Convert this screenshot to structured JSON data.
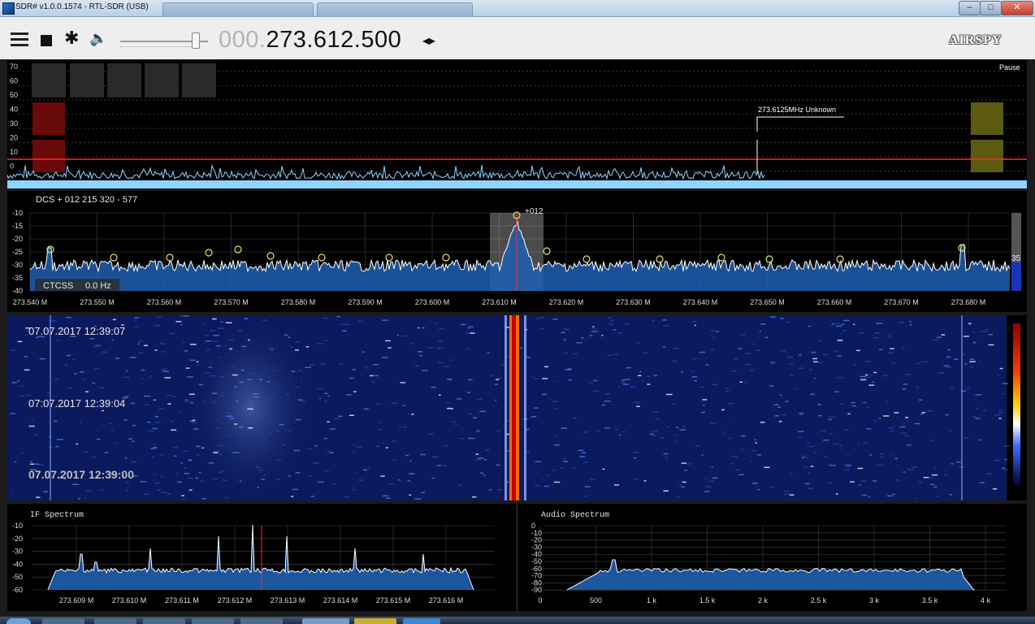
{
  "window": {
    "title": "SDR# v1.0.0.1574 - RTL-SDR (USB)",
    "minimize_glyph": "–",
    "maximize_glyph": "□",
    "close_glyph": "✕"
  },
  "toolbar": {
    "icons": [
      "menu-icon",
      "stop-icon",
      "gear-icon",
      "speaker-icon"
    ],
    "volume_level": 0.88,
    "frequency_dim": "000.",
    "frequency_main": "273.612.500",
    "tune_arrows_glyph": "◂▸",
    "logo": "AIRSPY"
  },
  "scanner": {
    "pause_label": "Pause",
    "y_ticks": [
      "70",
      "60",
      "50",
      "40",
      "30",
      "20",
      "10",
      "0"
    ],
    "marker_label": "273.6125MHz Unknown",
    "colors": {
      "trace": "#8fd3ff",
      "threshold": "#ff2a2a",
      "red_block": "#6a0a0a",
      "yellow_block": "#5c5a10"
    }
  },
  "spectrum": {
    "dcs_label": "DCS + 012 215 320  - 577",
    "ctcss_label": "CTCSS",
    "ctcss_value": "0.0 Hz",
    "peak_label": "+012",
    "level_value": "35",
    "y_ticks": [
      "-10",
      "-15",
      "-20",
      "-25",
      "-30",
      "-35",
      "-40"
    ],
    "x_ticks": [
      "273.540 M",
      "273.550 M",
      "273.560 M",
      "273.570 M",
      "273.580 M",
      "273.590 M",
      "273.600 M",
      "273.610 M",
      "273.620 M",
      "273.630 M",
      "273.640 M",
      "273.650 M",
      "273.660 M",
      "273.670 M",
      "273.680 M"
    ],
    "colors": {
      "fill": "#1e5fb0",
      "line": "#ffffff",
      "marker": "#e8e36a",
      "filter": "#d8d8d8"
    }
  },
  "waterfall": {
    "timestamps": [
      "07.07.2017 12:39:07",
      "07.07.2017 12:39:04",
      "07.07.2017 12:39:00"
    ],
    "colors": {
      "background": "#0b1a5e",
      "hot": "#ff6a00"
    }
  },
  "if_spectrum": {
    "title": "IF Spectrum",
    "y_ticks": [
      "-10",
      "-20",
      "-30",
      "-40",
      "-50",
      "-60"
    ],
    "x_ticks": [
      "273.609 M",
      "273.610 M",
      "273.611 M",
      "273.612 M",
      "273.613 M",
      "273.614 M",
      "273.615 M",
      "273.616 M"
    ]
  },
  "audio_spectrum": {
    "title": "Audio Spectrum",
    "y_ticks": [
      "0",
      "-10",
      "-20",
      "-30",
      "-40",
      "-50",
      "-60",
      "-70",
      "-80",
      "-90"
    ],
    "x_ticks": [
      "0",
      "500",
      "1 k",
      "1.5 k",
      "2 k",
      "2.5 k",
      "3 k",
      "3.5 k",
      "4 k"
    ]
  }
}
